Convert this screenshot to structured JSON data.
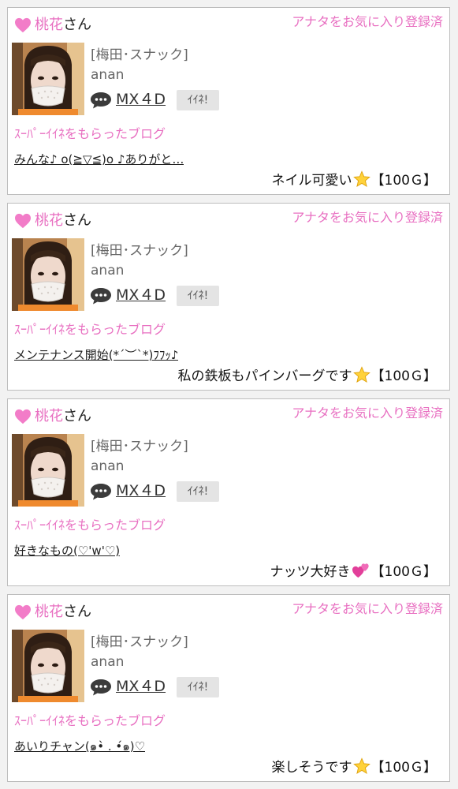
{
  "colors": {
    "accent_pink": "#e86fc1",
    "heart_pink": "#f27cc8",
    "card_border": "#bdbdbd",
    "like_button_bg": "#e4e4e4"
  },
  "icons": {
    "heart": "heart-icon",
    "chat": "speech-bubble-icon",
    "star": "star-emoji",
    "hearts": "two-hearts-emoji"
  },
  "cards": [
    {
      "user": {
        "name": "桃花",
        "honorific": "さん"
      },
      "fav_status": "アナタをお気に入り登録済",
      "shop_label": "[梅田･スナック]",
      "handle": "anan",
      "profile_link": "MX４D",
      "like_label": "ｲｲﾈ!",
      "section_title": "ｽｰﾊﾟｰｲｲﾈをもらったブログ",
      "blog_title": "みんな♪ o(≧▽≦)o ♪ありがと…",
      "comment": {
        "text": "ネイル可愛い",
        "emoji": "star",
        "points": "【100Ｇ】"
      }
    },
    {
      "user": {
        "name": "桃花",
        "honorific": "さん"
      },
      "fav_status": "アナタをお気に入り登録済",
      "shop_label": "[梅田･スナック]",
      "handle": "anan",
      "profile_link": "MX４D",
      "like_label": "ｲｲﾈ!",
      "section_title": "ｽｰﾊﾟｰｲｲﾈをもらったブログ",
      "blog_title": "メンテナンス開始(*´︶`*)ﾌﾌｯ♪",
      "comment": {
        "text": "私の鉄板もパインバーグです",
        "emoji": "star",
        "points": "【100Ｇ】"
      }
    },
    {
      "user": {
        "name": "桃花",
        "honorific": "さん"
      },
      "fav_status": "アナタをお気に入り登録済",
      "shop_label": "[梅田･スナック]",
      "handle": "anan",
      "profile_link": "MX４D",
      "like_label": "ｲｲﾈ!",
      "section_title": "ｽｰﾊﾟｰｲｲﾈをもらったブログ",
      "blog_title": "好きなもの(♡'w'♡)",
      "comment": {
        "text": "ナッツ大好き",
        "emoji": "hearts",
        "points": "【100Ｇ】"
      }
    },
    {
      "user": {
        "name": "桃花",
        "honorific": "さん"
      },
      "fav_status": "アナタをお気に入り登録済",
      "shop_label": "[梅田･スナック]",
      "handle": "anan",
      "profile_link": "MX４D",
      "like_label": "ｲｲﾈ!",
      "section_title": "ｽｰﾊﾟｰｲｲﾈをもらったブログ",
      "blog_title": "あいりチャン(๑•̀ . •́๑)♡",
      "comment": {
        "text": "楽しそうです",
        "emoji": "star",
        "points": "【100Ｇ】"
      }
    }
  ]
}
